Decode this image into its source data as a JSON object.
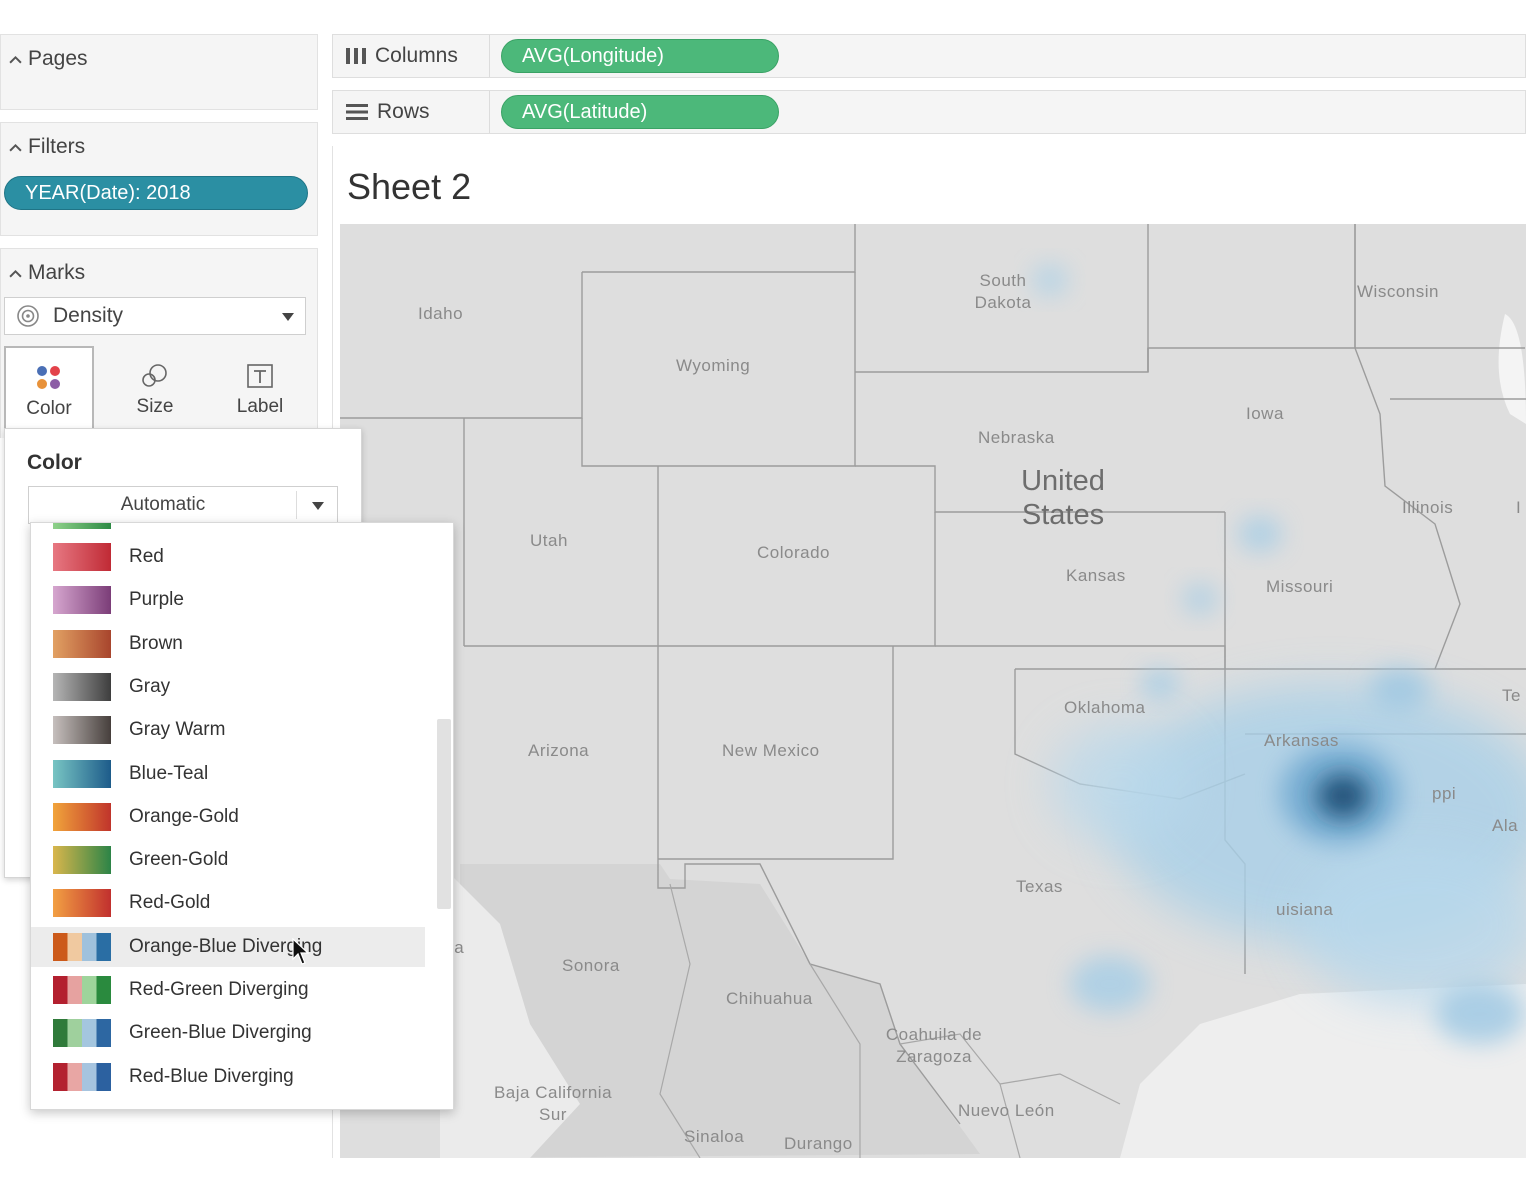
{
  "left_panel": {
    "pages": {
      "title": "Pages"
    },
    "filters": {
      "title": "Filters",
      "pills": [
        "YEAR(Date): 2018"
      ]
    },
    "marks": {
      "title": "Marks",
      "mark_type": "Density",
      "buttons": [
        {
          "label": "Color",
          "icon": "color-dots-icon"
        },
        {
          "label": "Size",
          "icon": "size-circles-icon"
        },
        {
          "label": "Label",
          "icon": "label-t-icon"
        }
      ]
    }
  },
  "color_popover": {
    "title": "Color",
    "dropdown_value": "Automatic",
    "palettes": [
      {
        "label": "Red",
        "colors": [
          "#e77882",
          "#c02a35"
        ]
      },
      {
        "label": "Purple",
        "colors": [
          "#d6a6cf",
          "#7b3d78"
        ]
      },
      {
        "label": "Brown",
        "colors": [
          "#e2a163",
          "#a8452d"
        ]
      },
      {
        "label": "Gray",
        "colors": [
          "#b5b5b5",
          "#3e3e3e"
        ]
      },
      {
        "label": "Gray Warm",
        "colors": [
          "#c6bfbd",
          "#463f3c"
        ]
      },
      {
        "label": "Blue-Teal",
        "colors": [
          "#78c5c3",
          "#1d5b8a"
        ]
      },
      {
        "label": "Orange-Gold",
        "colors": [
          "#f1a43b",
          "#c0342b"
        ]
      },
      {
        "label": "Green-Gold",
        "colors": [
          "#d9b64c",
          "#2c8447"
        ]
      },
      {
        "label": "Red-Gold",
        "colors": [
          "#f2a043",
          "#c1302e"
        ]
      },
      {
        "label": "Orange-Blue Diverging",
        "colors": [
          "#cc5a1a",
          "#f0c9a0",
          "#9fc1dc",
          "#2a6ea4"
        ]
      },
      {
        "label": "Red-Green Diverging",
        "colors": [
          "#b3202f",
          "#e6a2a0",
          "#9ed49b",
          "#2a8a3e"
        ]
      },
      {
        "label": "Green-Blue Diverging",
        "colors": [
          "#2f7a3a",
          "#9fd09d",
          "#a4c6df",
          "#2d67a2"
        ]
      },
      {
        "label": "Red-Blue Diverging",
        "colors": [
          "#b32230",
          "#e8a6a4",
          "#a6c4df",
          "#2c61a0"
        ]
      }
    ],
    "hovered": "Orange-Blue Diverging"
  },
  "shelves": {
    "columns": {
      "label": "Columns",
      "pill": "AVG(Longitude)"
    },
    "rows": {
      "label": "Rows",
      "pill": "AVG(Latitude)"
    }
  },
  "sheet": {
    "title": "Sheet 2",
    "map": {
      "country": "United States",
      "regions": [
        "South Dakota",
        "Idaho",
        "Wyoming",
        "Wisconsin",
        "Iowa",
        "Nebraska",
        "Illinois",
        "Utah",
        "Colorado",
        "Kansas",
        "Missouri",
        "Oklahoma",
        "Arizona",
        "New Mexico",
        "Arkansas",
        "Texas",
        "Sonora",
        "Chihuahua",
        "Coahuila de Zaragoza",
        "Baja California Sur",
        "Nuevo León",
        "Sinaloa",
        "Durango"
      ],
      "cut_off_labels": [
        "Te",
        "Ala",
        "ia",
        "ppi",
        "uisiana",
        "I"
      ],
      "density_color_light": "#a9d0e8",
      "density_color_dark": "#1d4d75"
    }
  },
  "colors": {
    "filter_pill": "#2b8fa3",
    "measure_pill": "#4cb87a",
    "map_background": "#dedede"
  }
}
